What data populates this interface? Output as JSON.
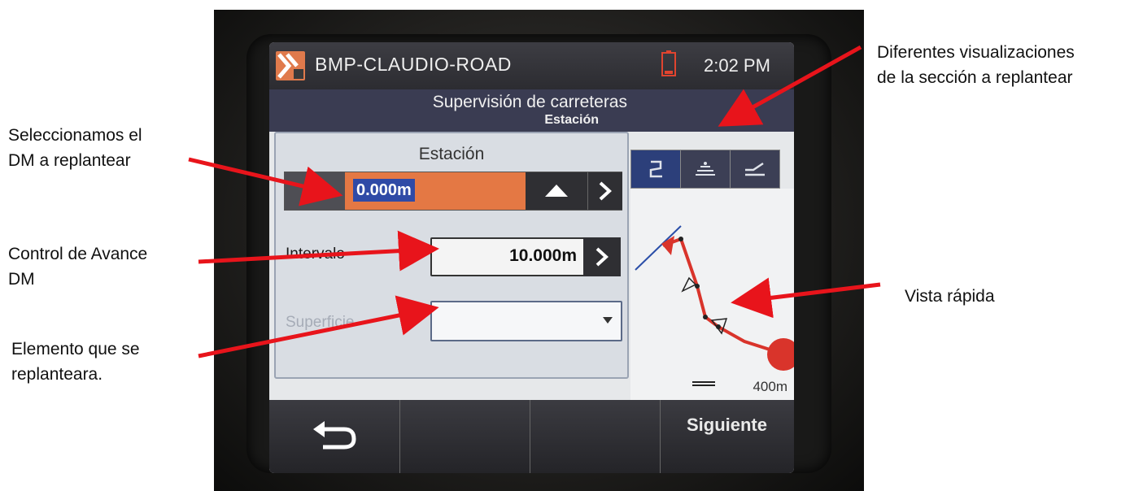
{
  "annotations": {
    "views": "Diferentes visualizaciones\nde la sección a replantear",
    "select_dm": "Seleccionamos el\nDM a replantear",
    "advance": "Control de Avance\nDM",
    "element": "Elemento que se\nreplanteara.",
    "quick_view": "Vista rápida",
    "arrow_color": "#e8141b"
  },
  "device": {
    "app_title": "BMP-CLAUDIO-ROAD",
    "time": "2:02 PM",
    "battery_icon": "battery-low-icon",
    "screen_title": "Supervisión de carreteras",
    "screen_subtitle": "Estación",
    "station": {
      "label": "Estación",
      "value": "0.000m"
    },
    "interval": {
      "label": "Intervalo",
      "value": "10.000m"
    },
    "surface": {
      "label": "Superficie",
      "value": ""
    },
    "views": [
      "plan-view-icon",
      "cross-section-icon",
      "profile-view-icon"
    ],
    "map": {
      "scale": "400m",
      "alignment_color": "#d9342b"
    },
    "softkeys": {
      "back_icon": "back-arrow-icon",
      "next": "Siguiente"
    },
    "colors": {
      "accent": "#e47844",
      "selection": "#2f4aa6",
      "header": "#3a3c52"
    }
  }
}
